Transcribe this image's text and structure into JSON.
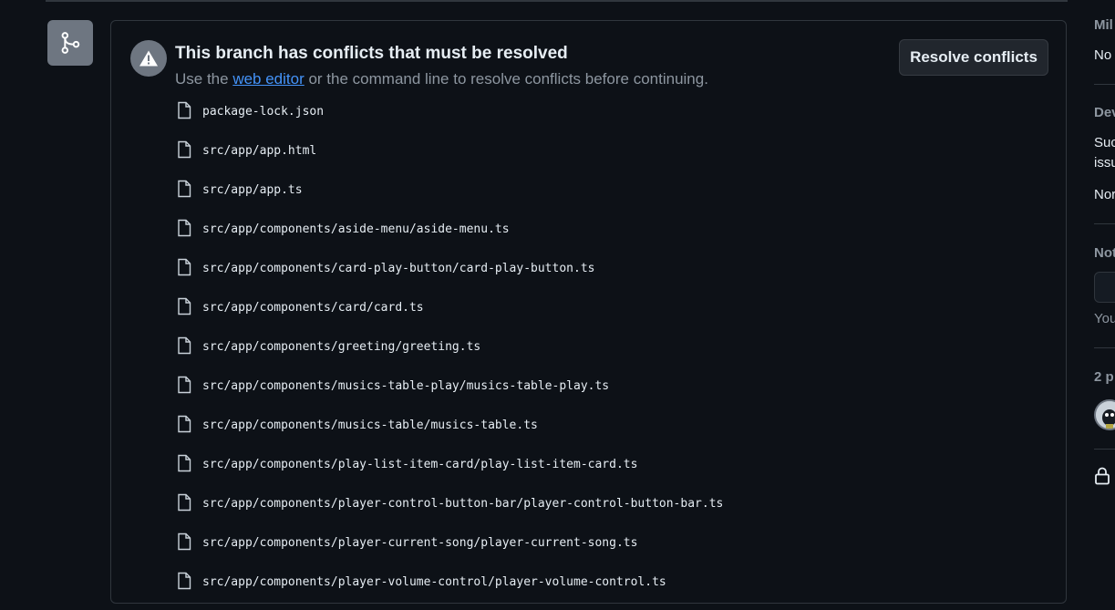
{
  "merge_box": {
    "icon": "git-merge-icon",
    "warning_icon": "alert-icon",
    "title": "This branch has conflicts that must be resolved",
    "description_prefix": "Use the ",
    "description_link": "web editor",
    "description_suffix": " or the command line to resolve conflicts before continuing.",
    "resolve_button": "Resolve conflicts",
    "file_icon": "file-icon",
    "conflicting_files": [
      "package-lock.json",
      "src/app/app.html",
      "src/app/app.ts",
      "src/app/components/aside-menu/aside-menu.ts",
      "src/app/components/card-play-button/card-play-button.ts",
      "src/app/components/card/card.ts",
      "src/app/components/greeting/greeting.ts",
      "src/app/components/musics-table-play/musics-table-play.ts",
      "src/app/components/musics-table/musics-table.ts",
      "src/app/components/play-list-item-card/play-list-item-card.ts",
      "src/app/components/player-control-button-bar/player-control-button-bar.ts",
      "src/app/components/player-current-song/player-current-song.ts",
      "src/app/components/player-volume-control/player-volume-control.ts"
    ]
  },
  "sidebar": {
    "milestone_heading": "Mil",
    "milestone_value": "No",
    "development_heading": "Dev",
    "development_line1": "Suc",
    "development_line2": "issu",
    "development_value": "Nor",
    "notifications_heading": "Not",
    "notifications_note": "You",
    "participants_heading": "2 p",
    "lock_icon": "lock-icon"
  },
  "colors": {
    "background": "#0d1117",
    "border": "#30363d",
    "text": "#e6edf3",
    "muted": "#8d96a0",
    "link": "#4493f8",
    "badge": "#6e7681",
    "button_bg": "#21262d"
  }
}
